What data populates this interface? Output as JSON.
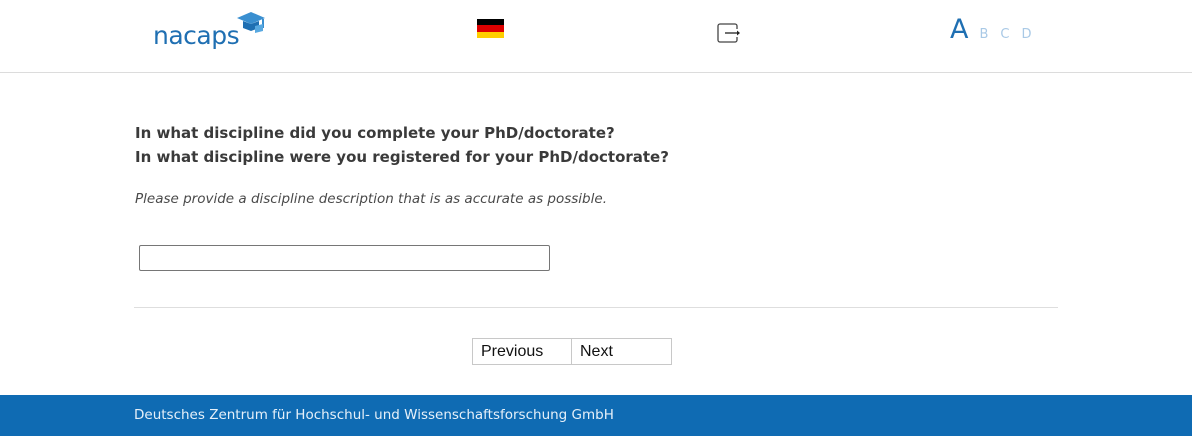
{
  "header": {
    "logo_text": "nacaps",
    "language_flag_icon": "german-flag-icon",
    "exit_icon": "exit-icon",
    "font_sizes": [
      "A",
      "B",
      "C",
      "D"
    ]
  },
  "question": {
    "line1": "In what discipline did you complete your PhD/doctorate?",
    "line2": "In what discipline were you registered for your PhD/doctorate?",
    "hint": "Please provide a discipline description that is as accurate as possible."
  },
  "answer": {
    "value": "",
    "placeholder": ""
  },
  "navigation": {
    "previous_label": "Previous",
    "next_label": "Next"
  },
  "footer": {
    "text": "Deutsches Zentrum für Hochschul- und Wissenschaftsforschung GmbH"
  },
  "colors": {
    "brand_blue": "#1f6fb2",
    "footer_blue": "#0f6bb3",
    "flag_black": "#000000",
    "flag_red": "#dd0000",
    "flag_gold": "#ffce00"
  }
}
